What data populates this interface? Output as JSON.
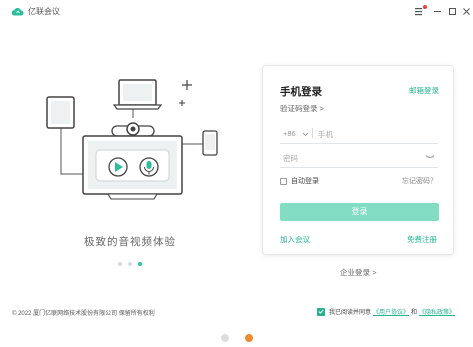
{
  "window": {
    "title": "亿联会议"
  },
  "illustration": {
    "slogan": "极致的音视频体验",
    "carousel_count": 3,
    "carousel_active": 2
  },
  "login": {
    "title": "手机登录",
    "mail_login": "邮箱登录",
    "code_login": "验证码登录 >",
    "country_code": "+86",
    "phone_placeholder": "手机",
    "password_placeholder": "密码",
    "remember": "自动登录",
    "forgot": "忘记密码？",
    "submit": "登录",
    "join_meeting": "加入会议",
    "register": "免费注册"
  },
  "enterprise_login": "企业登录 >",
  "footer": {
    "copyright": "© 2022 厦门亿联网络技术股份有限公司 保留所有权利",
    "agree_prefix": "我已阅读并同意",
    "user_agreement": "《用户协议》",
    "and": "和",
    "privacy_policy": "《隐私政策》"
  },
  "pager": {
    "count": 2,
    "active": 1
  },
  "colors": {
    "accent": "#25b591",
    "button_disabled": "#83dcc4",
    "pager_active": "#ef8a33"
  }
}
